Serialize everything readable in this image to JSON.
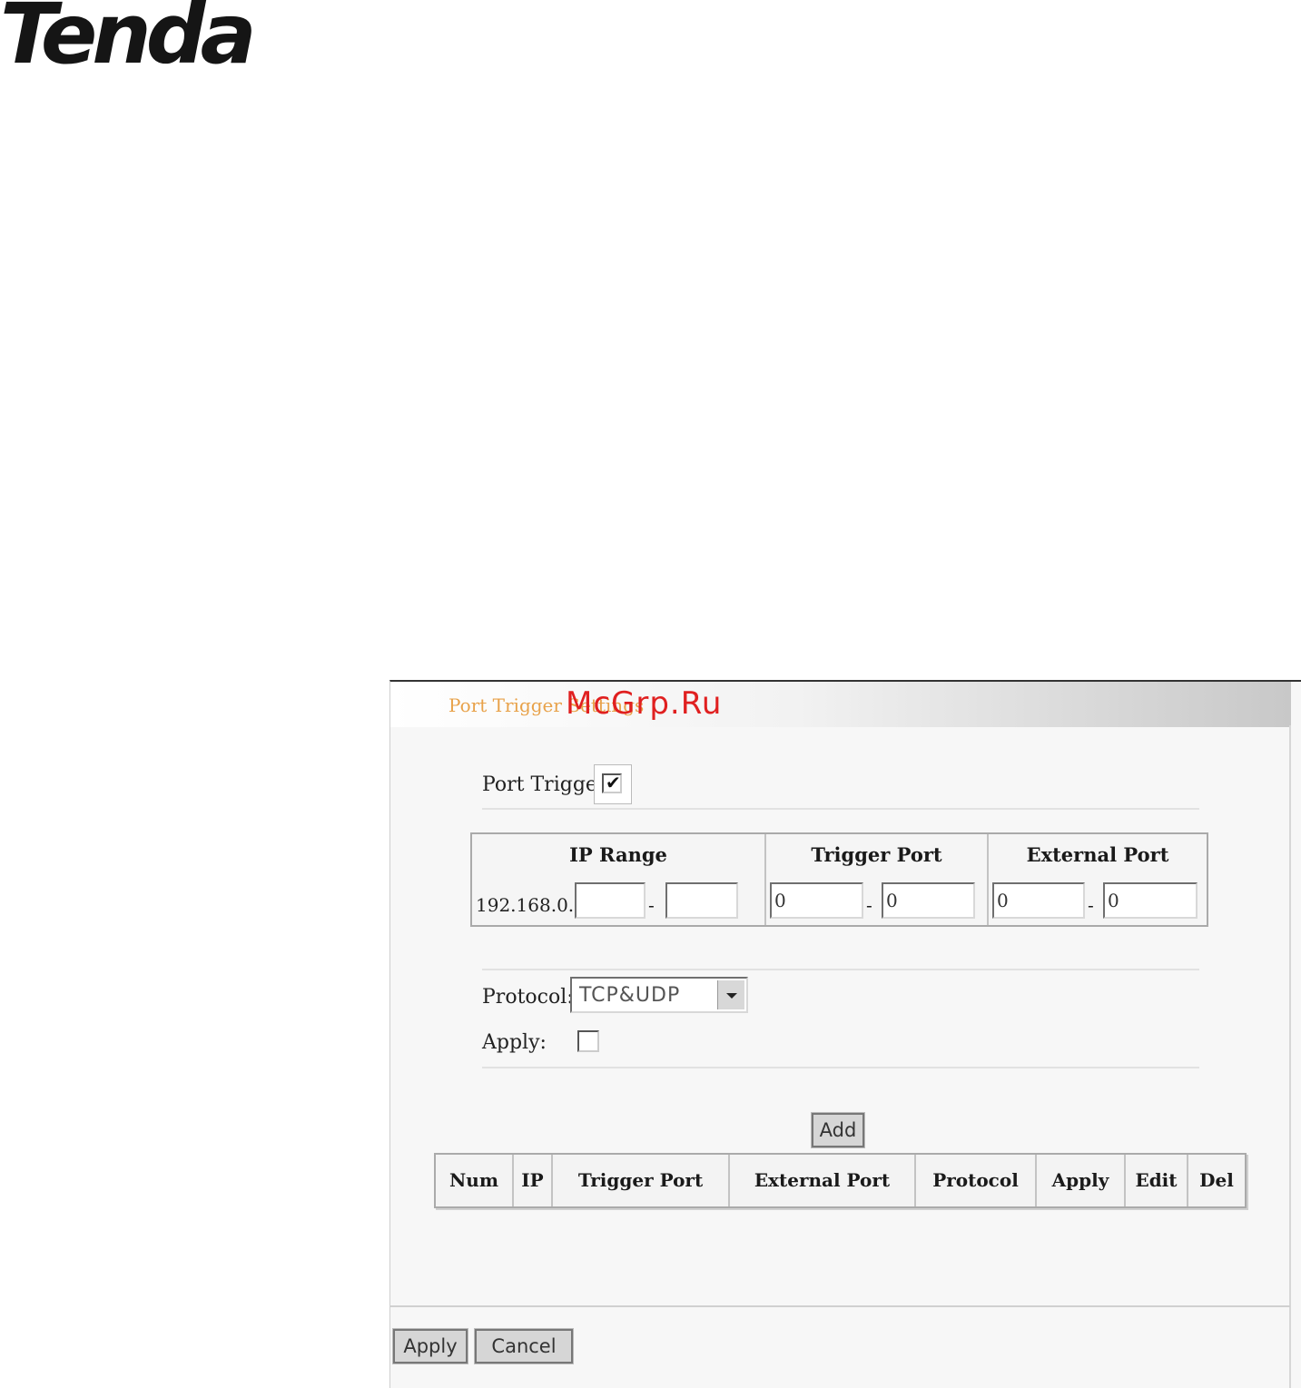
{
  "logo": {
    "text": "Tenda",
    "registered": "®"
  },
  "panel": {
    "title": "Port Trigger Settings",
    "watermark": "McGrp.Ru"
  },
  "port_trigger": {
    "label": "Port Trigger:",
    "checked": true,
    "check_glyph": "✔"
  },
  "range_table": {
    "headers": [
      "IP Range",
      "Trigger Port",
      "External Port"
    ],
    "ip_prefix": "192.168.0.",
    "ip_start": "",
    "ip_end": "",
    "trigger_start": "0",
    "trigger_end": "0",
    "external_start": "0",
    "external_end": "0",
    "separator": "-"
  },
  "protocol": {
    "label": "Protocol:",
    "selected": "TCP&UDP"
  },
  "apply_row": {
    "label": "Apply:",
    "checked": false
  },
  "add_button": "Add",
  "list_table": {
    "headers": [
      "Num",
      "IP",
      "Trigger Port",
      "External Port",
      "Protocol",
      "Apply",
      "Edit",
      "Del"
    ]
  },
  "footer": {
    "apply_label": "Apply",
    "cancel_label": "Cancel"
  }
}
